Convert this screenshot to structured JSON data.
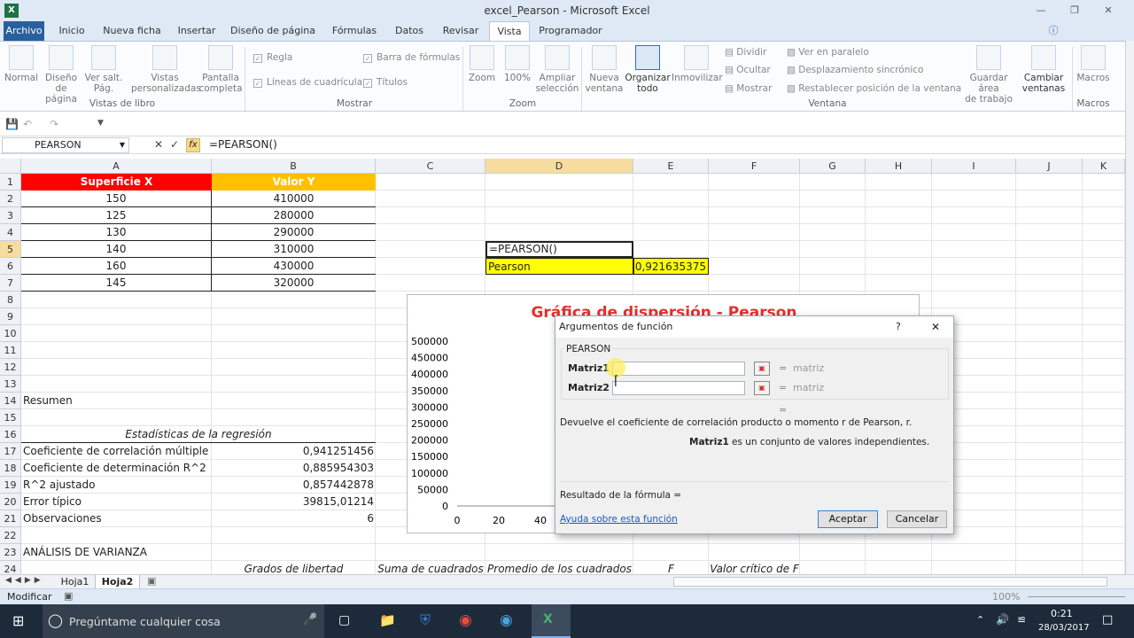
{
  "window": {
    "title": "excel_Pearson - Microsoft Excel",
    "logo": "X"
  },
  "tabs": [
    "Archivo",
    "Inicio",
    "Nueva ficha",
    "Insertar",
    "Diseño de página",
    "Fórmulas",
    "Datos",
    "Revisar",
    "Vista",
    "Programador"
  ],
  "ribbon": {
    "workbook_views": {
      "normal": "Normal",
      "page_layout_1": "Diseño de",
      "page_layout_2": "página",
      "page_break_1": "Ver salt.",
      "page_break_2": "Pág.",
      "custom_1": "Vistas",
      "custom_2": "personalizadas",
      "full_1": "Pantalla",
      "full_2": "completa",
      "group": "Vistas de libro"
    },
    "show": {
      "ruler": "Regla",
      "gridlines": "Líneas de cuadrícula",
      "formula_bar": "Barra de fórmulas",
      "headings": "Títulos",
      "group": "Mostrar"
    },
    "zoom": {
      "zoom": "Zoom",
      "zoom100": "100%",
      "selection_1": "Ampliar",
      "selection_2": "selección",
      "group": "Zoom"
    },
    "window": {
      "new_1": "Nueva",
      "new_2": "ventana",
      "arrange_1": "Organizar",
      "arrange_2": "todo",
      "freeze": "Inmovilizar",
      "split": "Dividir",
      "hide": "Ocultar",
      "unhide": "Mostrar",
      "side_by_side": "Ver en paralelo",
      "sync_scroll": "Desplazamiento sincrónico",
      "reset_pos": "Restablecer posición de la ventana",
      "save_ws_1": "Guardar área",
      "save_ws_2": "de trabajo",
      "switch_1": "Cambiar",
      "switch_2": "ventanas",
      "group": "Ventana"
    },
    "macros": {
      "label": "Macros",
      "group": "Macros"
    }
  },
  "formula_bar": {
    "name_box": "PEARSON",
    "fx": "fx",
    "formula": "=PEARSON()"
  },
  "columns": [
    "A",
    "B",
    "C",
    "D",
    "E",
    "F",
    "G",
    "H",
    "I",
    "J",
    "K"
  ],
  "rows": [
    "1",
    "2",
    "3",
    "4",
    "5",
    "6",
    "7",
    "8",
    "9",
    "10",
    "11",
    "12",
    "13",
    "14",
    "15",
    "16",
    "17",
    "18",
    "19",
    "20",
    "21",
    "22",
    "23",
    "24"
  ],
  "table": {
    "header_x": "Superficie X",
    "header_y": "Valor  Y",
    "data": [
      [
        "150",
        "410000"
      ],
      [
        "125",
        "280000"
      ],
      [
        "130",
        "290000"
      ],
      [
        "140",
        "310000"
      ],
      [
        "160",
        "430000"
      ],
      [
        "145",
        "320000"
      ]
    ]
  },
  "cells": {
    "d5": "=PEARSON()",
    "d6": "Pearson",
    "e6": "0,921635375"
  },
  "summary": {
    "title": "Resumen",
    "reg_title": "Estadísticas de la regresión",
    "stats": [
      [
        "Coeficiente de correlación múltiple",
        "0,941251456"
      ],
      [
        "Coeficiente de determinación R^2",
        "0,885954303"
      ],
      [
        "R^2  ajustado",
        "0,857442878"
      ],
      [
        "Error típico",
        "39815,01214"
      ],
      [
        "Observaciones",
        "6"
      ]
    ],
    "anova": "ANÁLISIS DE VARIANZA",
    "anova_headers": [
      "Grados de libertad",
      "Suma de cuadrados",
      "Promedio de los cuadrados",
      "F",
      "Valor crítico de F"
    ]
  },
  "chart_data": {
    "type": "scatter",
    "title": "Gráfica de dispersión - Pearson",
    "ylim": [
      0,
      500000
    ],
    "yticks": [
      "500000",
      "450000",
      "400000",
      "350000",
      "300000",
      "250000",
      "200000",
      "150000",
      "100000",
      "50000",
      "0"
    ],
    "xticks": [
      "0",
      "20",
      "40"
    ],
    "x": [],
    "y": []
  },
  "dialog": {
    "title": "Argumentos de función",
    "help_icon": "?",
    "close": "✕",
    "func": "PEARSON",
    "arg1": "Matriz1",
    "arg2": "Matriz2",
    "eq": "=",
    "hint1": "matriz",
    "hint2": "matriz",
    "eq3": "=",
    "description": "Devuelve el coeficiente de correlación producto o momento r de Pearson, r.",
    "arg_name": "Matriz1",
    "arg_desc": "es un conjunto de valores independientes.",
    "result": "Resultado de la fórmula =",
    "help_link": "Ayuda sobre esta función",
    "ok": "Aceptar",
    "cancel": "Cancelar"
  },
  "sheets": [
    "Hoja1",
    "Hoja2"
  ],
  "status": {
    "mode": "Modificar",
    "zoom": "100%"
  },
  "taskbar": {
    "search": "Pregúntame cualquier cosa",
    "time": "0:21",
    "date": "28/03/2017"
  },
  "colors": {
    "header_x": "#ff0000",
    "header_y": "#ffc000",
    "pearson": "#ffff00",
    "chart_title": "#e4312d"
  }
}
